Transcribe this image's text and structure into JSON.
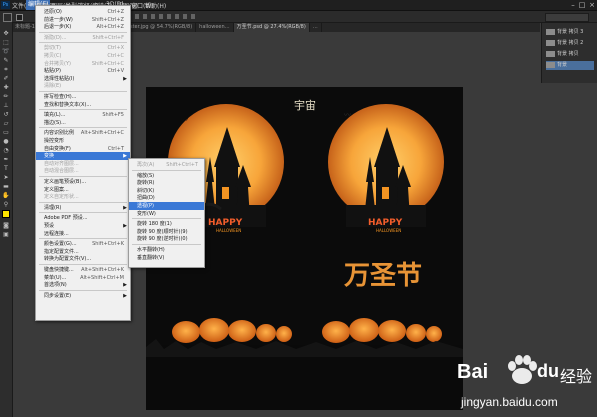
{
  "menubar": {
    "items": [
      "文件(F)",
      "编辑(E)",
      "图像(I)",
      "图层(L)",
      "类型(Y)",
      "选择(S)",
      "滤镜(T)",
      "3D(D)",
      "视图(V)",
      "窗口(W)",
      "帮助(H)"
    ],
    "active_index": 1,
    "window_buttons": [
      "–",
      "□",
      "×"
    ]
  },
  "tabs": [
    {
      "label": "未标题-1 @ 100%(RGB/8)",
      "active": false
    },
    {
      "label": "…by-flat-sheep-poster.jpg @ 54.7%(RGB/8)",
      "active": false
    },
    {
      "label": "halloween…",
      "active": false
    },
    {
      "label": "万圣节.psd @ 27.4%(RGB/8)",
      "active": true
    },
    {
      "label": "…",
      "active": false
    }
  ],
  "layers": [
    {
      "label": "背景 拷贝 3",
      "selected": false
    },
    {
      "label": "背景 拷贝 2",
      "selected": false
    },
    {
      "label": "背景 拷贝",
      "selected": false
    },
    {
      "label": "背景",
      "selected": true
    }
  ],
  "edit_menu": {
    "items": [
      {
        "label": "还原(O)",
        "shortcut": "Ctrl+Z",
        "disabled": false
      },
      {
        "label": "前进一步(W)",
        "shortcut": "Shift+Ctrl+Z",
        "disabled": false
      },
      {
        "label": "后退一步(K)",
        "shortcut": "Alt+Ctrl+Z",
        "disabled": false
      },
      {
        "sep": true
      },
      {
        "label": "渐隐(D)...",
        "shortcut": "Shift+Ctrl+F",
        "disabled": true
      },
      {
        "sep": true
      },
      {
        "label": "剪切(T)",
        "shortcut": "Ctrl+X",
        "disabled": true
      },
      {
        "label": "拷贝(C)",
        "shortcut": "Ctrl+C",
        "disabled": true
      },
      {
        "label": "合并拷贝(Y)",
        "shortcut": "Shift+Ctrl+C",
        "disabled": true
      },
      {
        "label": "粘贴(P)",
        "shortcut": "Ctrl+V",
        "disabled": false
      },
      {
        "label": "选择性粘贴(I)",
        "shortcut": "",
        "disabled": false,
        "arrow": true
      },
      {
        "label": "清除(E)",
        "shortcut": "",
        "disabled": true
      },
      {
        "sep": true
      },
      {
        "label": "拼写检查(H)...",
        "shortcut": "",
        "disabled": false
      },
      {
        "label": "查找和替换文本(X)...",
        "shortcut": "",
        "disabled": false
      },
      {
        "sep": true
      },
      {
        "label": "填充(L)...",
        "shortcut": "Shift+F5",
        "disabled": false
      },
      {
        "label": "描边(S)...",
        "shortcut": "",
        "disabled": false
      },
      {
        "sep": true
      },
      {
        "label": "内容识别比例",
        "shortcut": "Alt+Shift+Ctrl+C",
        "disabled": false
      },
      {
        "label": "操控变形",
        "shortcut": "",
        "disabled": false
      },
      {
        "label": "自由变换(F)",
        "shortcut": "Ctrl+T",
        "disabled": false
      },
      {
        "label": "变换",
        "shortcut": "",
        "disabled": false,
        "arrow": true,
        "highlighted": true
      },
      {
        "label": "自动对齐图层...",
        "shortcut": "",
        "disabled": true
      },
      {
        "label": "自动混合图层...",
        "shortcut": "",
        "disabled": true
      },
      {
        "sep": true
      },
      {
        "label": "定义画笔预设(B)...",
        "shortcut": "",
        "disabled": false
      },
      {
        "label": "定义图案...",
        "shortcut": "",
        "disabled": false
      },
      {
        "label": "定义自定形状...",
        "shortcut": "",
        "disabled": true
      },
      {
        "sep": true
      },
      {
        "label": "清理(R)",
        "shortcut": "",
        "disabled": false,
        "arrow": true
      },
      {
        "sep": true
      },
      {
        "label": "Adobe PDF 预设...",
        "shortcut": "",
        "disabled": false
      },
      {
        "label": "预设",
        "shortcut": "",
        "disabled": false,
        "arrow": true
      },
      {
        "label": "远程连接...",
        "shortcut": "",
        "disabled": false
      },
      {
        "sep": true
      },
      {
        "label": "颜色设置(G)...",
        "shortcut": "Shift+Ctrl+K",
        "disabled": false
      },
      {
        "label": "指定配置文件...",
        "shortcut": "",
        "disabled": false
      },
      {
        "label": "转换为配置文件(V)...",
        "shortcut": "",
        "disabled": false
      },
      {
        "sep": true
      },
      {
        "label": "键盘快捷键...",
        "shortcut": "Alt+Shift+Ctrl+K",
        "disabled": false
      },
      {
        "label": "菜单(U)...",
        "shortcut": "Alt+Shift+Ctrl+M",
        "disabled": false
      },
      {
        "label": "首选项(N)",
        "shortcut": "",
        "disabled": false,
        "arrow": true
      },
      {
        "sep": true
      },
      {
        "label": "同步设置(E)",
        "shortcut": "",
        "disabled": false,
        "arrow": true
      }
    ]
  },
  "transform_menu": {
    "items": [
      {
        "label": "再次(A)",
        "shortcut": "Shift+Ctrl+T",
        "disabled": true
      },
      {
        "sep": true
      },
      {
        "label": "缩放(S)",
        "shortcut": ""
      },
      {
        "label": "旋转(R)",
        "shortcut": ""
      },
      {
        "label": "斜切(K)",
        "shortcut": ""
      },
      {
        "label": "扭曲(D)",
        "shortcut": ""
      },
      {
        "label": "透视(P)",
        "shortcut": "",
        "highlighted": true
      },
      {
        "label": "变形(W)",
        "shortcut": ""
      },
      {
        "sep": true
      },
      {
        "label": "旋转 180 度(1)",
        "shortcut": ""
      },
      {
        "label": "旋转 90 度(顺时针)(9)",
        "shortcut": ""
      },
      {
        "label": "旋转 90 度(逆时针)(0)",
        "shortcut": ""
      },
      {
        "sep": true
      },
      {
        "label": "水平翻转(H)",
        "shortcut": ""
      },
      {
        "label": "垂直翻转(V)",
        "shortcut": ""
      }
    ]
  },
  "poster": {
    "top_text": "宇宙",
    "happy_text": "HAPPY",
    "halloween_small": "HALLOWEEN",
    "title": "万圣节"
  },
  "watermark": {
    "brand": "Bai",
    "brand2": "du",
    "jingyan": "经验",
    "url": "jingyan.baidu.com"
  },
  "colors": {
    "accent": "#3a78d6",
    "moon": "#f7a53a",
    "pumpkin": "#f39422",
    "title_orange": "#e89436",
    "happy": "#f25d2b"
  }
}
